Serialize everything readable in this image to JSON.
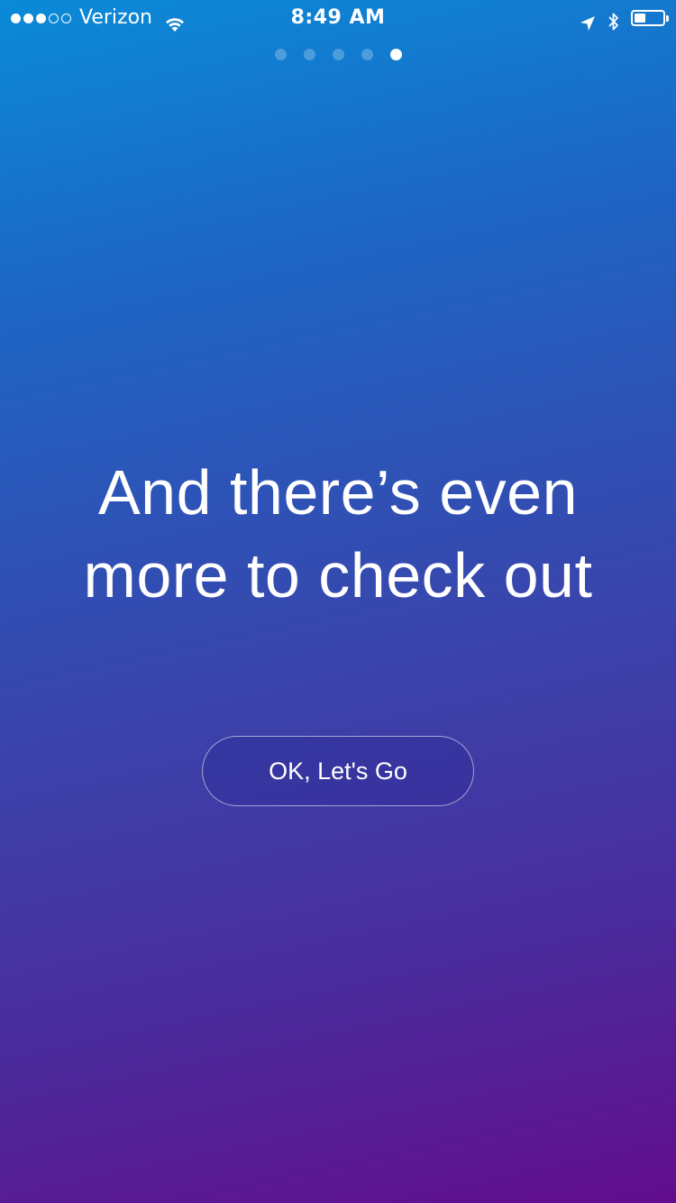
{
  "status_bar": {
    "signal": {
      "filled": 3,
      "total": 5
    },
    "carrier": "Verizon",
    "time": "8:49 AM",
    "battery_level": 0.4,
    "icons": [
      "wifi-icon",
      "location-icon",
      "bluetooth-icon",
      "battery-icon"
    ]
  },
  "pager": {
    "total": 5,
    "active_index": 4
  },
  "onboarding": {
    "headline_line1": "And there’s even",
    "headline_line2": "more to check out",
    "cta_label": "OK, Let's Go"
  },
  "colors": {
    "gradient_top": "#0a8ad8",
    "gradient_bottom": "#620d8c",
    "text": "#ffffff"
  }
}
